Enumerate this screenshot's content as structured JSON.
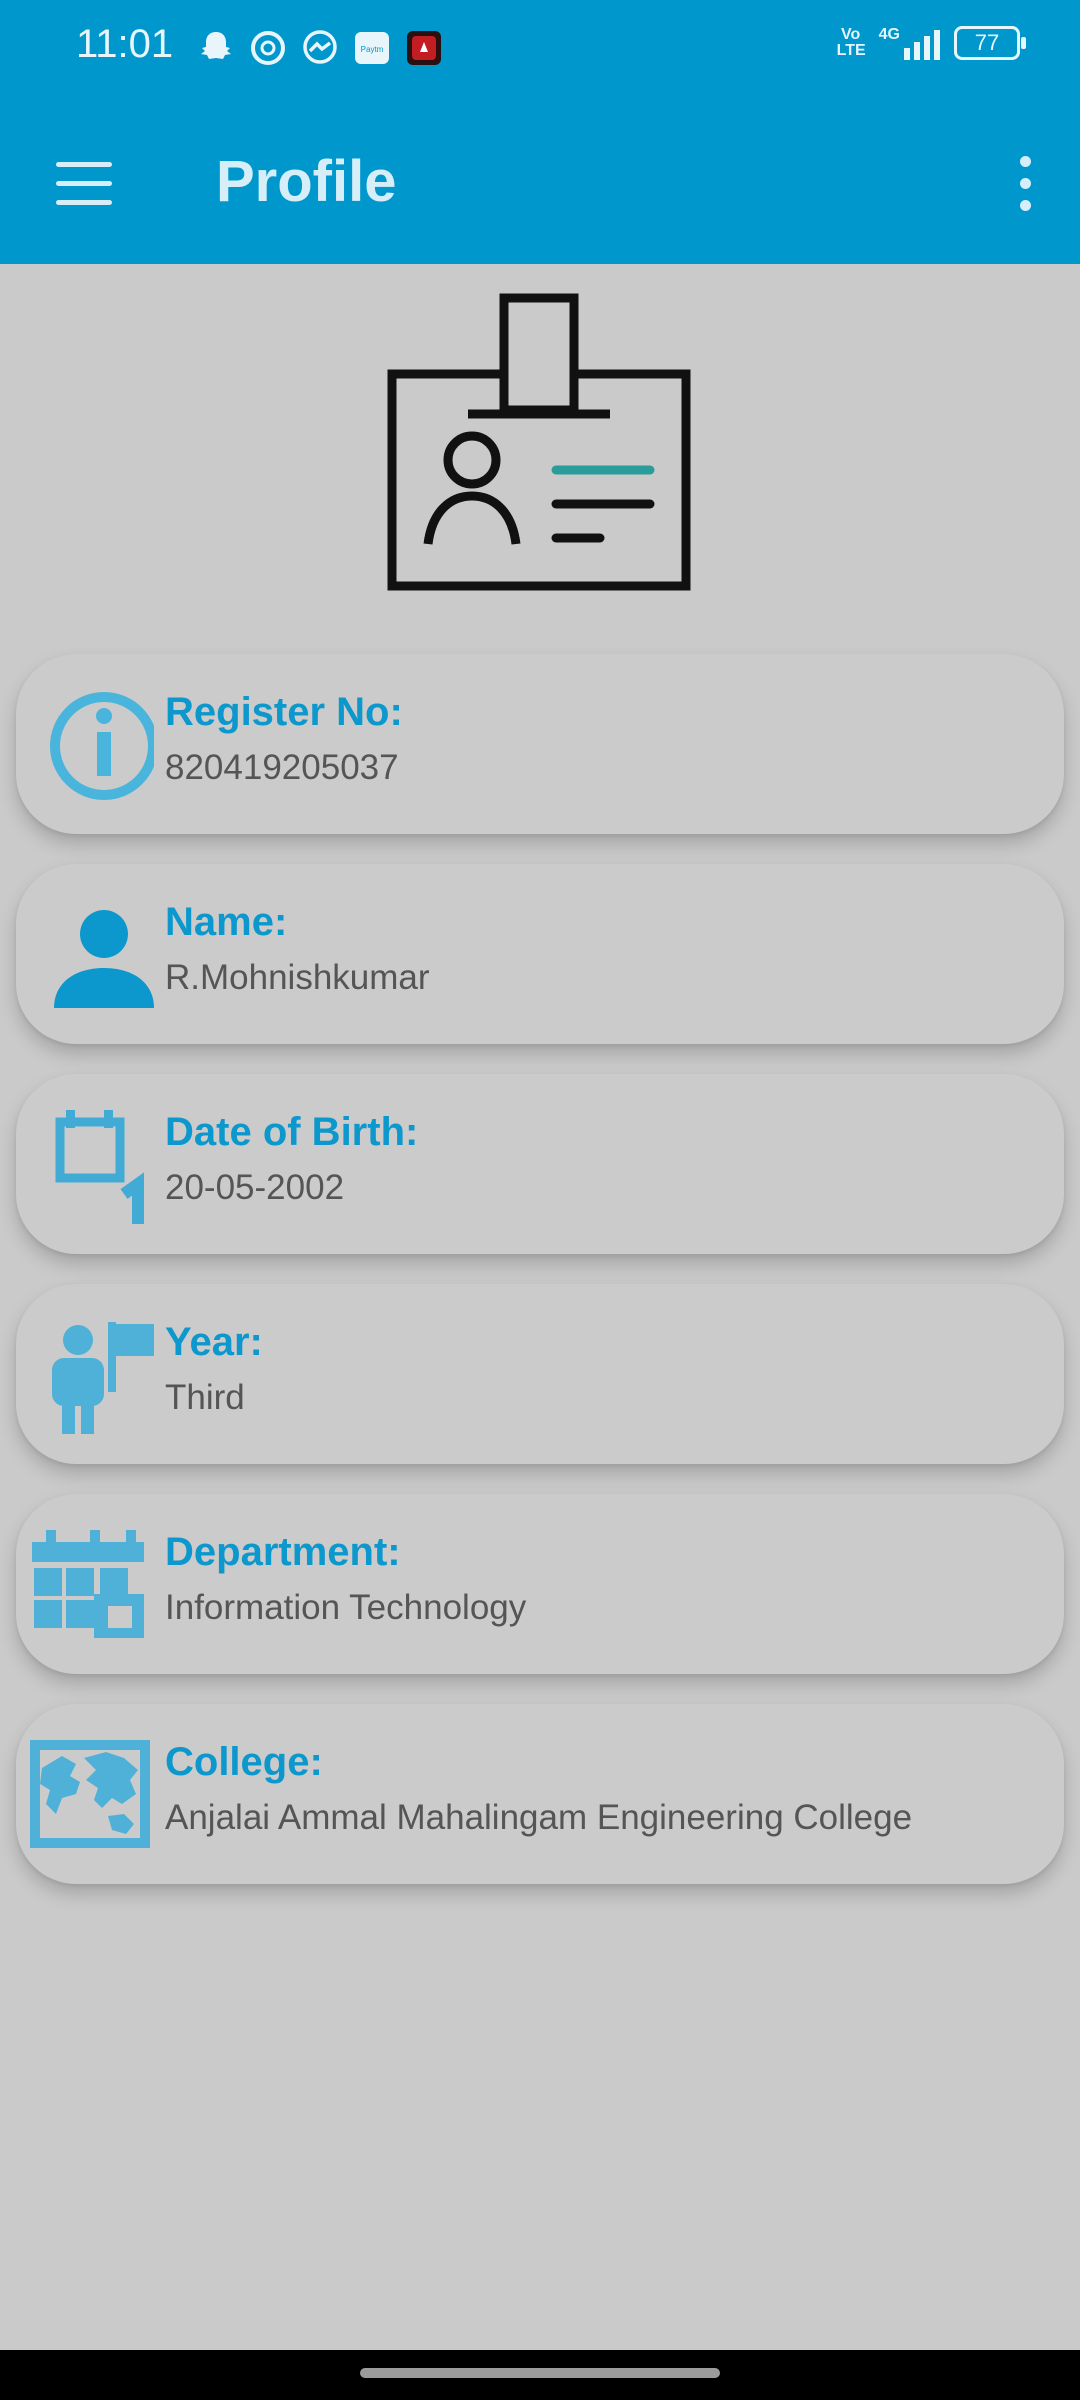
{
  "status_bar": {
    "time": "11:01",
    "notification_icons": [
      "snapchat-icon",
      "chrome-icon",
      "messenger-icon",
      "paytm-icon",
      "app-icon"
    ],
    "paytm_label": "Paytm",
    "network_label": "Vo LTE",
    "signal_label": "4G",
    "battery_level": "77"
  },
  "app_bar": {
    "title": "Profile"
  },
  "colors": {
    "primary": "#0097cc",
    "label_blue": "#0c98cc",
    "card_background": "#cbcbcb",
    "page_background": "#cacaca",
    "value_text": "#555555"
  },
  "profile": {
    "register_no": {
      "label": "Register No:",
      "value": "820419205037",
      "icon": "info-icon"
    },
    "name": {
      "label": "Name:",
      "value": "R.Mohnishkumar",
      "icon": "person-icon"
    },
    "dob": {
      "label": "Date of Birth:",
      "value": "20-05-2002",
      "icon": "calendar-day-icon"
    },
    "year": {
      "label": "Year:",
      "value": "Third",
      "icon": "student-flag-icon"
    },
    "department": {
      "label": "Department:",
      "value": "Information Technology",
      "icon": "department-calendar-icon"
    },
    "college": {
      "label": "College:",
      "value": "Anjalai Ammal Mahalingam Engineering College",
      "icon": "world-map-icon"
    }
  }
}
